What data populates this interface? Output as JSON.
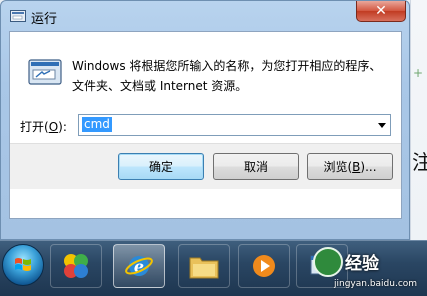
{
  "window": {
    "title": "运行",
    "close_glyph": "✕",
    "icon": "run-dialog-icon"
  },
  "dialog": {
    "description_line1": "Windows 将根据您所输入的名称，为您打开相应的程序、",
    "description_line2": "文件夹、文档或 Internet 资源。",
    "open_label_prefix": "打开(",
    "open_label_key": "O",
    "open_label_suffix": "):",
    "input_value": "cmd"
  },
  "buttons": {
    "ok": "确定",
    "cancel": "取消",
    "browse_prefix": "浏览(",
    "browse_key": "B",
    "browse_suffix": ")..."
  },
  "background": {
    "side_char": "注"
  },
  "taskbar": {
    "items": [
      "start-orb",
      "app-icon",
      "ie-icon",
      "folder-icon",
      "media-player-icon",
      "window-icon"
    ]
  },
  "watermark": {
    "brand": "经验",
    "url": "jingyan.baidu.com"
  },
  "colors": {
    "selection": "#3399ff",
    "close_button": "#c13b22",
    "taskbar": "#2a4663"
  }
}
